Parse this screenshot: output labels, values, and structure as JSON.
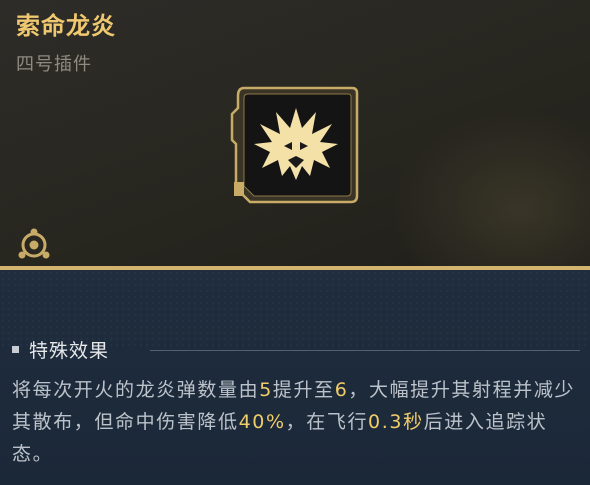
{
  "item": {
    "name": "索命龙炎",
    "type": "四号插件"
  },
  "icons": {
    "main_icon": "dragon-flame-icon",
    "slot_icon": "slot-hexagon-icon"
  },
  "effect": {
    "header": "特殊效果",
    "parts": [
      {
        "text": "将每次开火的龙炎弹数量由",
        "highlight": false
      },
      {
        "text": "5",
        "highlight": true
      },
      {
        "text": "提升至",
        "highlight": false
      },
      {
        "text": "6",
        "highlight": true
      },
      {
        "text": "，大幅提升其射程并减少其散布，但命中伤害降低",
        "highlight": false
      },
      {
        "text": "40%",
        "highlight": true
      },
      {
        "text": "，在飞行",
        "highlight": false
      },
      {
        "text": "0.3秒",
        "highlight": true
      },
      {
        "text": "后进入追踪状态。",
        "highlight": false
      }
    ]
  },
  "colors": {
    "title_gold": "#efc870",
    "highlight": "#f1cd6a",
    "divider_gold": "#d2b46e",
    "top_bg": "#2a2924",
    "bottom_bg": "#1c2a3a"
  }
}
